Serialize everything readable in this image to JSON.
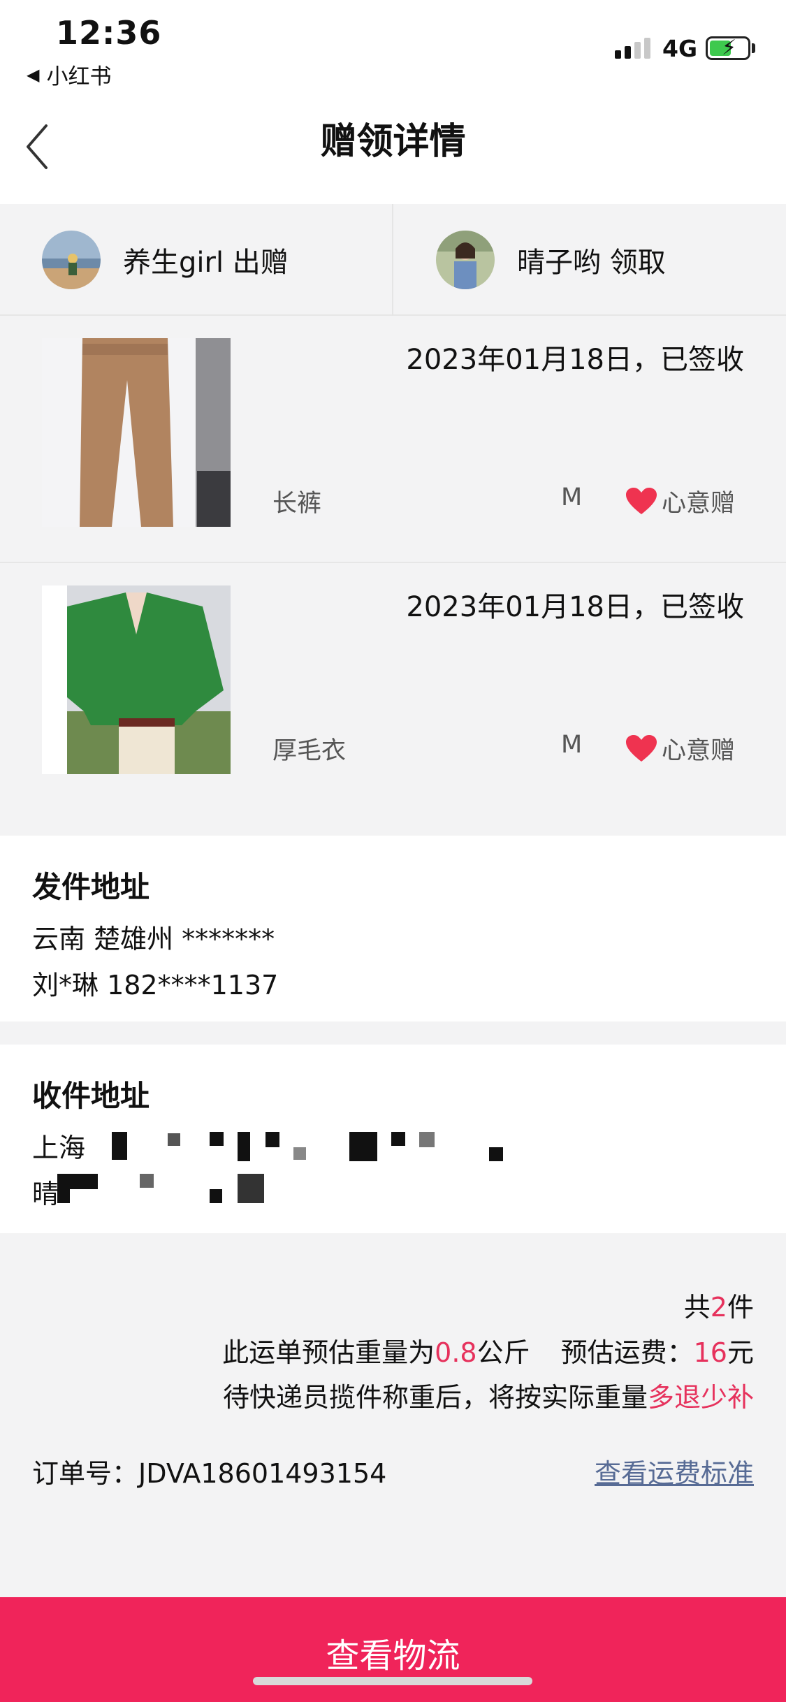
{
  "status_bar": {
    "time": "12:36",
    "back_app": "小红书",
    "network": "4G"
  },
  "nav": {
    "title": "赠领详情"
  },
  "users": {
    "giver": {
      "name": "养生girl",
      "action": "出赠"
    },
    "receiver": {
      "name": "晴子哟",
      "action": "领取"
    }
  },
  "items": [
    {
      "date_status": "2023年01月18日，已签收",
      "name": "长裤",
      "size": "M",
      "tag": "心意赠"
    },
    {
      "date_status": "2023年01月18日，已签收",
      "name": "厚毛衣",
      "size": "M",
      "tag": "心意赠"
    }
  ],
  "sender": {
    "title": "发件地址",
    "region": "云南 楚雄州 *******",
    "contact": "刘*琳 182****1137"
  },
  "receiver_addr": {
    "title": "收件地址",
    "line1_prefix": "上海",
    "line2_prefix": "晴"
  },
  "summary": {
    "count_prefix": "共",
    "count": "2",
    "count_suffix": "件",
    "weight_prefix": "此运单预估重量为",
    "weight": "0.8",
    "weight_unit": "公斤",
    "fee_prefix": "预估运费：",
    "fee": "16",
    "fee_unit": "元",
    "note_prefix": "待快递员揽件称重后，将按实际重量",
    "note_highlight": "多退少补",
    "order_label": "订单号：",
    "order_no": "JDVA18601493154",
    "fee_standard_link": "查看运费标准"
  },
  "bottom": {
    "button_label": "查看物流"
  },
  "colors": {
    "accent": "#f0245a",
    "highlight": "#e6315c",
    "link": "#576b95"
  }
}
